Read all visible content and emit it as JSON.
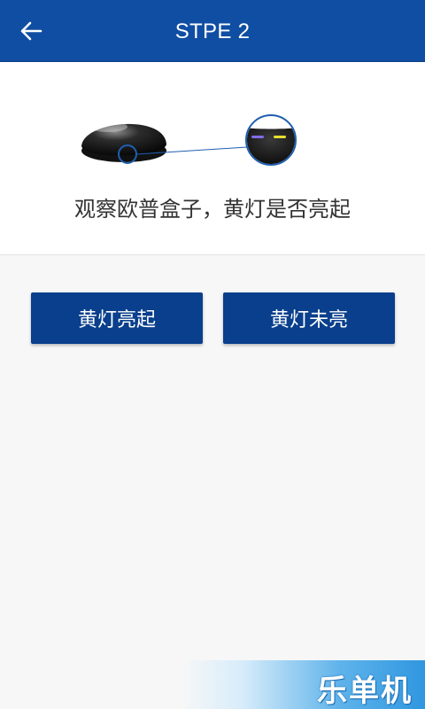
{
  "appbar": {
    "title": "STPE 2",
    "back_icon": "arrow-left-icon"
  },
  "step": {
    "instruction": "观察欧普盒子，黄灯是否亮起",
    "illustration": {
      "device": "remote-hub-device",
      "indicator_colors": [
        "#7f6cf0",
        "#e8e030"
      ]
    }
  },
  "actions": {
    "light_on_label": "黄灯亮起",
    "light_off_label": "黄灯未亮"
  },
  "watermark": {
    "text": "乐单机"
  },
  "colors": {
    "primary": "#0f4ea2",
    "button": "#093f8c",
    "background": "#f7f7f7"
  }
}
